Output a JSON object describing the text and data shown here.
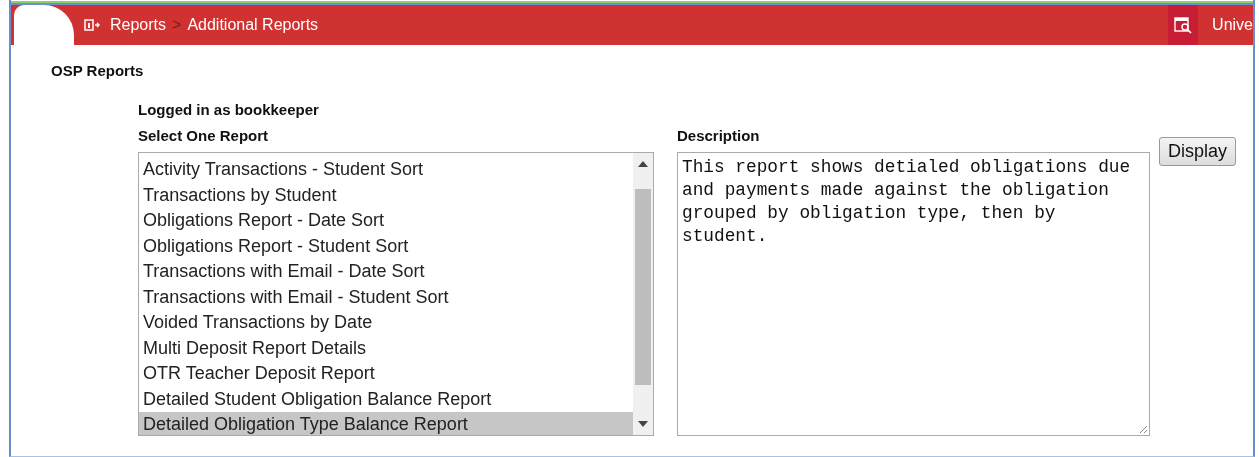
{
  "header": {
    "breadcrumb": [
      {
        "label": "Reports"
      },
      {
        "label": "Additional Reports"
      }
    ],
    "separator": ">",
    "user_label": "Unive"
  },
  "page_title": "OSP Reports",
  "logged_in": "Logged in as bookkeeper",
  "report_list": {
    "label": "Select One Report",
    "items": [
      {
        "label": "Activity Transactions - Student Sort",
        "selected": false
      },
      {
        "label": "Transactions by Student",
        "selected": false
      },
      {
        "label": "Obligations Report - Date Sort",
        "selected": false
      },
      {
        "label": "Obligations Report - Student Sort",
        "selected": false
      },
      {
        "label": "Transactions with Email - Date Sort",
        "selected": false
      },
      {
        "label": "Transactions with Email - Student Sort",
        "selected": false
      },
      {
        "label": "Voided Transactions by Date",
        "selected": false
      },
      {
        "label": "Multi Deposit Report Details",
        "selected": false
      },
      {
        "label": "OTR Teacher Deposit Report",
        "selected": false
      },
      {
        "label": "Detailed Student Obligation Balance Report",
        "selected": false
      },
      {
        "label": "Detailed Obligation Type Balance Report",
        "selected": true
      }
    ]
  },
  "description": {
    "label": "Description",
    "value": "This report shows detialed obligations due and payments made against the obligation grouped by obligation type, then by student."
  },
  "display_button": "Display"
}
